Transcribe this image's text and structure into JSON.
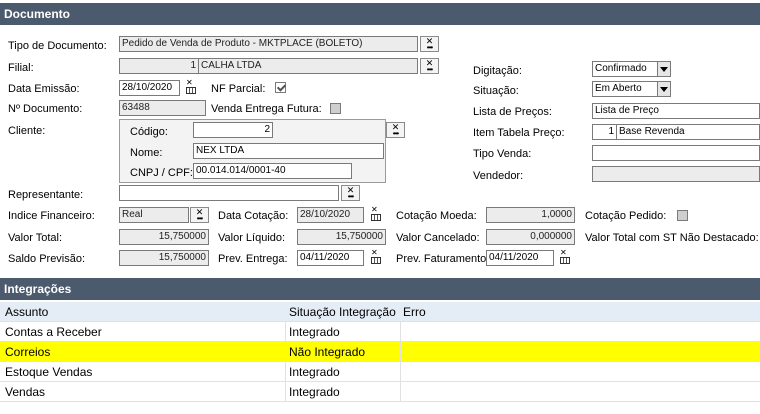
{
  "documento": {
    "title": "Documento",
    "tipo_documento": {
      "label": "Tipo de Documento:",
      "value": "Pedido de Venda de Produto - MKTPLACE (BOLETO)"
    },
    "filial": {
      "label": "Filial:",
      "code": "1",
      "name": "CALHA LTDA"
    },
    "data_emissao": {
      "label": "Data Emissão:",
      "value": "28/10/2020"
    },
    "nf_parcial": {
      "label": "NF Parcial:",
      "checked": true
    },
    "n_documento": {
      "label": "Nº Documento:",
      "value": "63488"
    },
    "venda_entrega_futura": {
      "label": "Venda Entrega Futura:",
      "checked": false
    },
    "cliente": {
      "label": "Cliente:",
      "codigo_label": "Código:",
      "codigo": "2",
      "nome_label": "Nome:",
      "nome": "NEX LTDA",
      "cnpj_label": "CNPJ / CPF:",
      "cnpj": "00.014.014/0001-40"
    },
    "representante": {
      "label": "Representante:",
      "value": ""
    },
    "digitacao": {
      "label": "Digitação:",
      "value": "Confirmado"
    },
    "situacao": {
      "label": "Situação:",
      "value": "Em Aberto"
    },
    "lista_precos": {
      "label": "Lista de Preços:",
      "value": "Lista de Preço"
    },
    "item_tabela_preco": {
      "label": "Item Tabela Preço:",
      "code": "1",
      "name": "Base Revenda"
    },
    "tipo_venda": {
      "label": "Tipo Venda:",
      "value": ""
    },
    "vendedor": {
      "label": "Vendedor:",
      "value": ""
    },
    "indice_financeiro": {
      "label": "Indice Financeiro:",
      "value": "Real"
    },
    "data_cotacao": {
      "label": "Data Cotação:",
      "value": "28/10/2020"
    },
    "cotacao_moeda": {
      "label": "Cotação Moeda:",
      "value": "1,0000"
    },
    "cotacao_pedido": {
      "label": "Cotação Pedido:",
      "checked": false
    },
    "valor_total": {
      "label": "Valor Total:",
      "value": "15,750000"
    },
    "valor_liquido": {
      "label": "Valor Líquido:",
      "value": "15,750000"
    },
    "valor_cancelado": {
      "label": "Valor Cancelado:",
      "value": "0,000000"
    },
    "valor_total_st": {
      "label": "Valor Total com ST Não Destacado:",
      "value": ""
    },
    "saldo_previsao": {
      "label": "Saldo Previsão:",
      "value": "15,750000"
    },
    "prev_entrega": {
      "label": "Prev. Entrega:",
      "value": "04/11/2020"
    },
    "prev_faturamento": {
      "label": "Prev. Faturamento:",
      "value": "04/11/2020"
    }
  },
  "integracoes": {
    "title": "Integrações",
    "columns": [
      "Assunto",
      "Situação Integração",
      "Erro"
    ],
    "rows": [
      {
        "assunto": "Contas a Receber",
        "situacao": "Integrado",
        "erro": ""
      },
      {
        "assunto": "Correios",
        "situacao": "Não Integrado",
        "erro": ""
      },
      {
        "assunto": "Estoque Vendas",
        "situacao": "Integrado",
        "erro": ""
      },
      {
        "assunto": "Vendas",
        "situacao": "Integrado",
        "erro": ""
      }
    ],
    "highlight_color": "#ffff00",
    "header_row_color": "#e4ecf6"
  },
  "colors": {
    "section_bar": "#4b5a6d",
    "readonly_field": "#ececec"
  }
}
